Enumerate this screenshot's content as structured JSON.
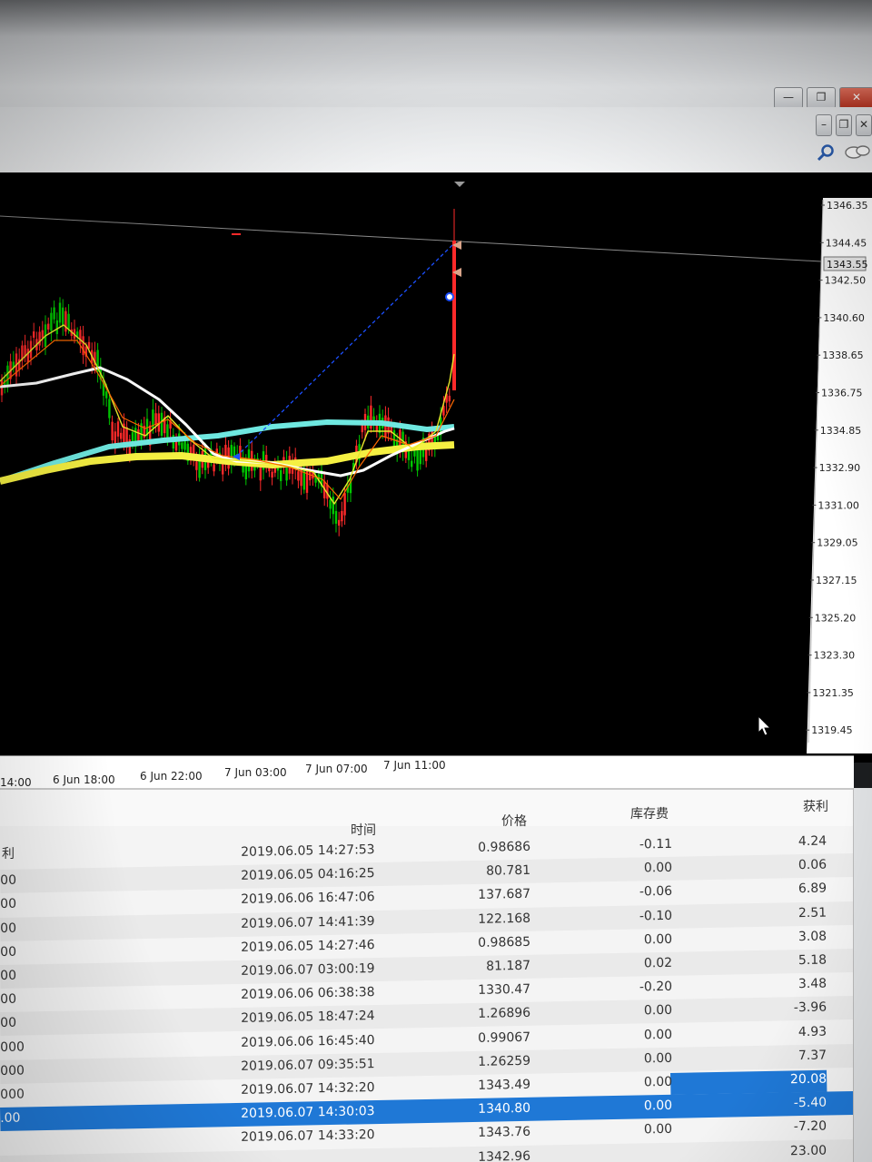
{
  "window": {
    "minimize_label": "—",
    "restore_label": "❐",
    "close_label": "✕",
    "child_minimize_label": "–",
    "child_restore_label": "❐",
    "child_close_label": "✕"
  },
  "toolbar": {
    "search_icon": "search-icon",
    "chat_icon": "chat-icon"
  },
  "chart": {
    "background": "#000000",
    "price_labels": [
      "1346.35",
      "1344.45",
      "1342.50",
      "1340.60",
      "1338.65",
      "1336.75",
      "1334.85",
      "1332.90",
      "1331.00",
      "1329.05",
      "1327.15",
      "1325.20",
      "1323.30",
      "1321.35",
      "1319.45"
    ],
    "current_price": "1343.55",
    "time_labels": [
      "14:00",
      "6 Jun 18:00",
      "6 Jun 22:00",
      "7 Jun 03:00",
      "7 Jun 07:00",
      "7 Jun 11:00"
    ],
    "colors": {
      "bull": "#00c800",
      "bear": "#ff2a2a",
      "ma_white": "#ffffff",
      "ma_cyan": "#6fe8e0",
      "ma_yellow": "#f5f042",
      "ma_thin_yellow": "#e8e82a",
      "ma_orange": "#ff6a00",
      "trend": "#1b4fff"
    }
  },
  "terminal": {
    "headers": {
      "left": "利",
      "time": "时间",
      "price": "价格",
      "swap": "库存费",
      "profit": "获利"
    },
    "rows": [
      {
        "left": "",
        "time": "2019.06.05 14:27:53",
        "price": "0.98686",
        "swap": "-0.11",
        "profit": "4.24"
      },
      {
        "left": "00",
        "time": "2019.06.05 04:16:25",
        "price": "80.781",
        "swap": "0.00",
        "profit": "0.06"
      },
      {
        "left": "00",
        "time": "2019.06.06 16:47:06",
        "price": "137.687",
        "swap": "-0.06",
        "profit": "6.89"
      },
      {
        "left": "00",
        "time": "2019.06.07 14:41:39",
        "price": "122.168",
        "swap": "-0.10",
        "profit": "2.51"
      },
      {
        "left": "00",
        "time": "2019.06.05 14:27:46",
        "price": "0.98685",
        "swap": "0.00",
        "profit": "3.08"
      },
      {
        "left": "00",
        "time": "2019.06.07 03:00:19",
        "price": "81.187",
        "swap": "0.02",
        "profit": "5.18"
      },
      {
        "left": "00",
        "time": "2019.06.06 06:38:38",
        "price": "1330.47",
        "swap": "-0.20",
        "profit": "3.48"
      },
      {
        "left": "00",
        "time": "2019.06.05 18:47:24",
        "price": "1.26896",
        "swap": "0.00",
        "profit": "-3.96"
      },
      {
        "left": "000",
        "time": "2019.06.06 16:45:40",
        "price": "0.99067",
        "swap": "0.00",
        "profit": "4.93"
      },
      {
        "left": "000",
        "time": "2019.06.07 09:35:51",
        "price": "1.26259",
        "swap": "0.00",
        "profit": "7.37"
      },
      {
        "left": "000",
        "time": "2019.06.07 14:32:20",
        "price": "1343.49",
        "swap": "0.00",
        "profit": "20.08"
      },
      {
        "left": ".00",
        "time": "2019.06.07 14:30:03",
        "price": "1340.80",
        "swap": "0.00",
        "profit": "-5.40"
      },
      {
        "left": "",
        "time": "2019.06.07 14:33:20",
        "price": "1343.76",
        "swap": "0.00",
        "profit": "-7.20"
      },
      {
        "left": "",
        "time": "",
        "price": "1342.96",
        "swap": "",
        "profit": "23.00"
      }
    ]
  }
}
